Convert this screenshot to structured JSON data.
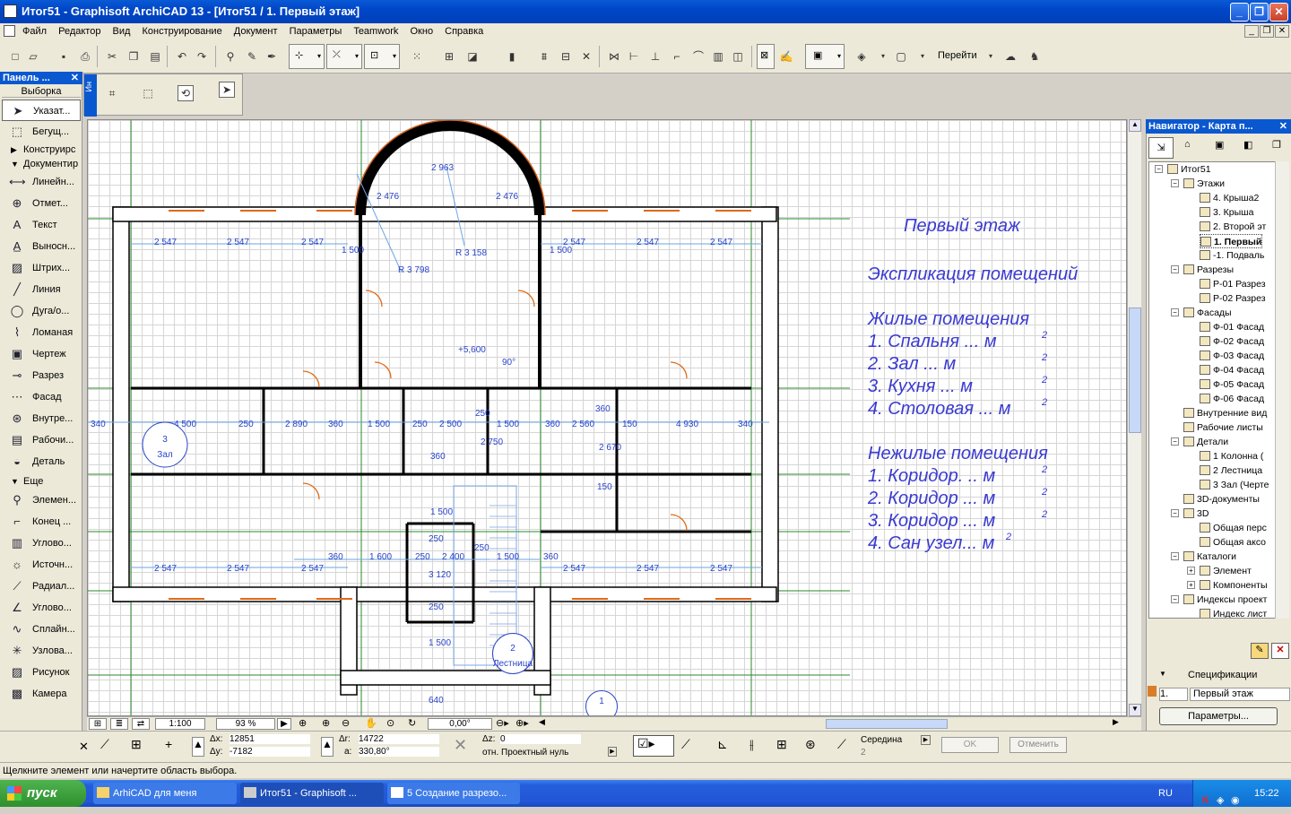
{
  "window": {
    "title": "Итог51 - Graphisoft ArchiCAD 13 - [Итог51 / 1. Первый этаж]"
  },
  "menu": [
    "Файл",
    "Редактор",
    "Вид",
    "Конструирование",
    "Документ",
    "Параметры",
    "Teamwork",
    "Окно",
    "Справка"
  ],
  "toolbar": {
    "goto_label": "Перейти"
  },
  "toolbox": {
    "title": "Панель ...",
    "section_select": "Выборка",
    "select_items": [
      {
        "label": "Указат...",
        "icon": "arrow-pointer-icon"
      },
      {
        "label": "Бегущ...",
        "icon": "marquee-icon"
      }
    ],
    "section_design": "Конструирс",
    "section_document": "Документир",
    "document_items": [
      {
        "label": "Линейн...",
        "icon": "linear-dimension-icon"
      },
      {
        "label": "Отмет...",
        "icon": "level-dimension-icon"
      },
      {
        "label": "Текст",
        "icon": "text-icon"
      },
      {
        "label": "Выносн...",
        "icon": "label-icon"
      },
      {
        "label": "Штрих...",
        "icon": "fill-icon"
      },
      {
        "label": "Линия",
        "icon": "line-icon"
      },
      {
        "label": "Дуга/о...",
        "icon": "arc-icon"
      },
      {
        "label": "Ломаная",
        "icon": "polyline-icon"
      },
      {
        "label": "Чертеж",
        "icon": "drawing-icon"
      },
      {
        "label": "Разрез",
        "icon": "section-icon"
      },
      {
        "label": "Фасад",
        "icon": "elevation-icon"
      },
      {
        "label": "Внутре...",
        "icon": "interior-elevation-icon"
      },
      {
        "label": "Рабочи...",
        "icon": "worksheet-icon"
      },
      {
        "label": "Деталь",
        "icon": "detail-icon"
      }
    ],
    "section_more": "Еще",
    "more_items": [
      {
        "label": "Элемен...",
        "icon": "element-icon"
      },
      {
        "label": "Конец ...",
        "icon": "end-icon"
      },
      {
        "label": "Углово...",
        "icon": "corner-icon"
      },
      {
        "label": "Источн...",
        "icon": "lamp-icon"
      },
      {
        "label": "Радиал...",
        "icon": "radial-dimension-icon"
      },
      {
        "label": "Углово...",
        "icon": "angle-dimension-icon"
      },
      {
        "label": "Сплайн...",
        "icon": "spline-icon"
      },
      {
        "label": "Узлова...",
        "icon": "hotspot-icon"
      },
      {
        "label": "Рисунок",
        "icon": "picture-icon"
      },
      {
        "label": "Камера",
        "icon": "camera-icon"
      }
    ]
  },
  "infobox": {
    "tab_label": "Ин"
  },
  "plan": {
    "title": "Первый этаж",
    "explication_title": "Экспликация помещений",
    "living_title": "Жилые помещения",
    "living": [
      "1. Спальня      ... м",
      "2. Зал              ... м",
      "3. Кухня          ... м",
      "4. Столовая      ... м"
    ],
    "nonliving_title": "Нежилые помещения",
    "nonliving": [
      "1. Коридор.       .. м",
      "2. Коридор        ... м",
      "3. Коридор        ... м",
      "4. Сан узел... м"
    ],
    "superscript": "2",
    "zones": [
      {
        "num": "3",
        "name": "Зал"
      },
      {
        "num": "2",
        "name": "Лестница"
      },
      {
        "num": "1",
        "name": ""
      }
    ],
    "level_mark": "+5,600",
    "angle_mark": "90°",
    "radius_labels": [
      "R 3 158",
      "R 3 798"
    ],
    "dims_top": [
      "2 963",
      "2 476",
      "2 476",
      "2 547",
      "2 547",
      "2 547",
      "1 500",
      "1 500",
      "2 547",
      "2 547",
      "2 547"
    ],
    "dims_mid": [
      "340",
      "4 500",
      "250",
      "2 890",
      "360",
      "1 500",
      "250",
      "2 500",
      "250",
      "1 500",
      "360",
      "2 560",
      "360",
      "150",
      "4 930",
      "340",
      "2 750",
      "2 670",
      "360",
      "150",
      "1 500"
    ],
    "dims_bottom": [
      "2 547",
      "2 547",
      "2 547",
      "360",
      "1 600",
      "250",
      "2 400",
      "250",
      "1 500",
      "360",
      "2 547",
      "2 547",
      "2 547",
      "250",
      "3 120",
      "250",
      "1 500",
      "640"
    ]
  },
  "hbar": {
    "scale": "1:100",
    "zoom": "93 %",
    "angle": "0,00°"
  },
  "navigator": {
    "title": "Навигатор - Карта п...",
    "tree": [
      {
        "label": "Итог51",
        "level": 0,
        "pm": "-"
      },
      {
        "label": "Этажи",
        "level": 1,
        "pm": "-"
      },
      {
        "label": "4. Крыша2",
        "level": 2
      },
      {
        "label": "3. Крыша",
        "level": 2
      },
      {
        "label": "2. Второй эт",
        "level": 2
      },
      {
        "label": "1. Первый",
        "level": 2,
        "selected": true
      },
      {
        "label": "-1. Подваль",
        "level": 2
      },
      {
        "label": "Разрезы",
        "level": 1,
        "pm": "-"
      },
      {
        "label": "Р-01 Разрез",
        "level": 2
      },
      {
        "label": "Р-02 Разрез",
        "level": 2
      },
      {
        "label": "Фасады",
        "level": 1,
        "pm": "-"
      },
      {
        "label": "Ф-01 Фасад",
        "level": 2
      },
      {
        "label": "Ф-02 Фасад",
        "level": 2
      },
      {
        "label": "Ф-03 Фасад",
        "level": 2
      },
      {
        "label": "Ф-04 Фасад",
        "level": 2
      },
      {
        "label": "Ф-05 Фасад",
        "level": 2
      },
      {
        "label": "Ф-06 Фасад",
        "level": 2
      },
      {
        "label": "Внутренние вид",
        "level": 1
      },
      {
        "label": "Рабочие листы",
        "level": 1
      },
      {
        "label": "Детали",
        "level": 1,
        "pm": "-"
      },
      {
        "label": "1 Колонна (",
        "level": 2
      },
      {
        "label": "2 Лестница",
        "level": 2
      },
      {
        "label": "3 Зал (Черте",
        "level": 2
      },
      {
        "label": "3D-документы",
        "level": 1
      },
      {
        "label": "3D",
        "level": 1,
        "pm": "-"
      },
      {
        "label": "Общая перс",
        "level": 2
      },
      {
        "label": "Общая аксо",
        "level": 2
      },
      {
        "label": "Каталоги",
        "level": 1,
        "pm": "-"
      },
      {
        "label": "Элемент",
        "level": 2,
        "pm": "+"
      },
      {
        "label": "Компоненты",
        "level": 2,
        "pm": "+"
      },
      {
        "label": "Индексы проект",
        "level": 1,
        "pm": "-"
      },
      {
        "label": "Индекс лист",
        "level": 2
      }
    ],
    "spec_label": "Спецификации",
    "spec_num": "1.",
    "spec_value": "Первый этаж",
    "params_button": "Параметры..."
  },
  "coords": {
    "dx_label": "Δx:",
    "dx": "12851",
    "dy_label": "Δy:",
    "dy": "-7182",
    "dr_label": "Δr:",
    "dr": "14722",
    "a_label": "a:",
    "a": "330,80°",
    "dz_label": "Δz:",
    "dz": "0",
    "ref": "отн. Проектный нуль"
  },
  "snap": {
    "label": "Середина",
    "value": "2"
  },
  "buttons": {
    "ok": "OK",
    "cancel": "Отменить"
  },
  "status": "Щелкните элемент или начертите область выбора.",
  "taskbar": {
    "start": "пуск",
    "tasks": [
      "ArhiCAD для меня",
      "Итог51 - Graphisoft ...",
      "5 Создание разрезо..."
    ],
    "lang": "RU",
    "time": "15:22"
  }
}
